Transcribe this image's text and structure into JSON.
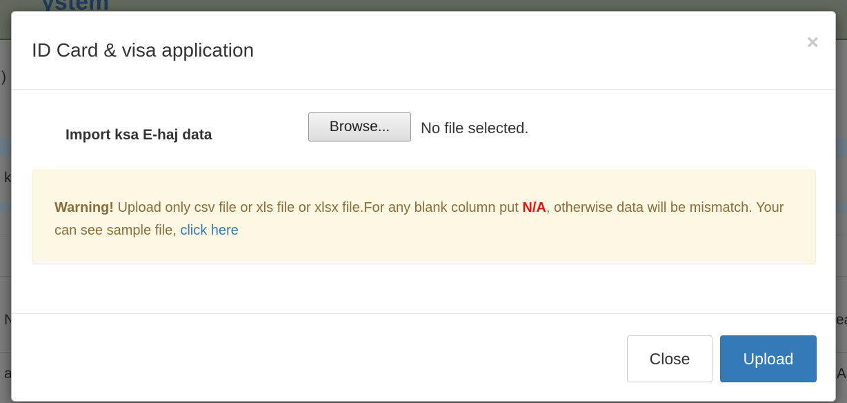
{
  "background": {
    "app_title_fragment": "ystem",
    "row_fragments": {
      "left_1": ")",
      "left_2": "k",
      "left_3": "N",
      "left_4": "a",
      "right_1": "ea",
      "right_2": "A"
    }
  },
  "modal": {
    "title": "ID Card & visa application",
    "close_symbol": "×",
    "body": {
      "import_label": "Import ksa E-haj data",
      "browse_label": "Browse...",
      "file_status": "No file selected.",
      "warning": {
        "strong": "Warning!",
        "text_before_na": " Upload only csv file or xls file or xlsx file.For any blank column put ",
        "na": "N/A",
        "text_after_na": ", otherwise data will be mismatch. Your can see sample file, ",
        "link_text": "click here"
      }
    },
    "footer": {
      "close_label": "Close",
      "upload_label": "Upload"
    }
  },
  "colors": {
    "primary": "#337ab7",
    "warning_bg": "#fcf8e3",
    "warning_text": "#8a6d3b",
    "na_highlight": "#e11414"
  }
}
